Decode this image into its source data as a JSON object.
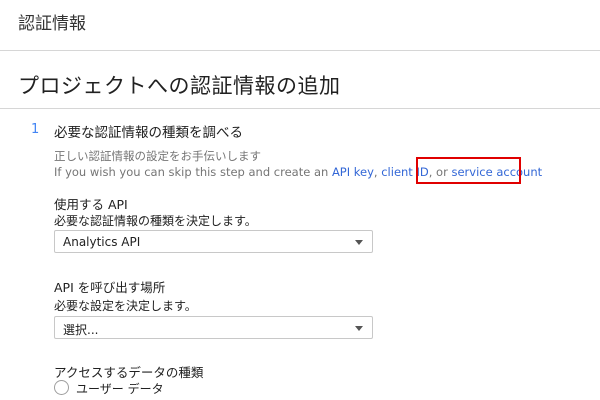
{
  "header": {
    "title": "認証情報"
  },
  "page": {
    "title": "プロジェクトへの認証情報の追加"
  },
  "step": {
    "number": "1",
    "heading": "必要な認証情報の種類を調べる",
    "help_text": "正しい認証情報の設定をお手伝いします",
    "skip_prefix": "If you wish you can skip this step and create an ",
    "link_api_key": "API key",
    "comma": ", ",
    "link_client_id": "client ID",
    "or_text": ", or ",
    "link_service_account": "service account"
  },
  "api_section": {
    "label": "使用する API",
    "caption": "必要な認証情報の種類を決定します。",
    "selected_value": "Analytics API"
  },
  "call_section": {
    "label": "API を呼び出す場所",
    "caption": "必要な設定を決定します。",
    "selected_value": "選択..."
  },
  "data_section": {
    "label": "アクセスするデータの種類",
    "option_user_data": "ユーザー データ"
  },
  "colors": {
    "link": "#3367d6",
    "highlight": "#e00000",
    "step_number": "#4285f4"
  }
}
